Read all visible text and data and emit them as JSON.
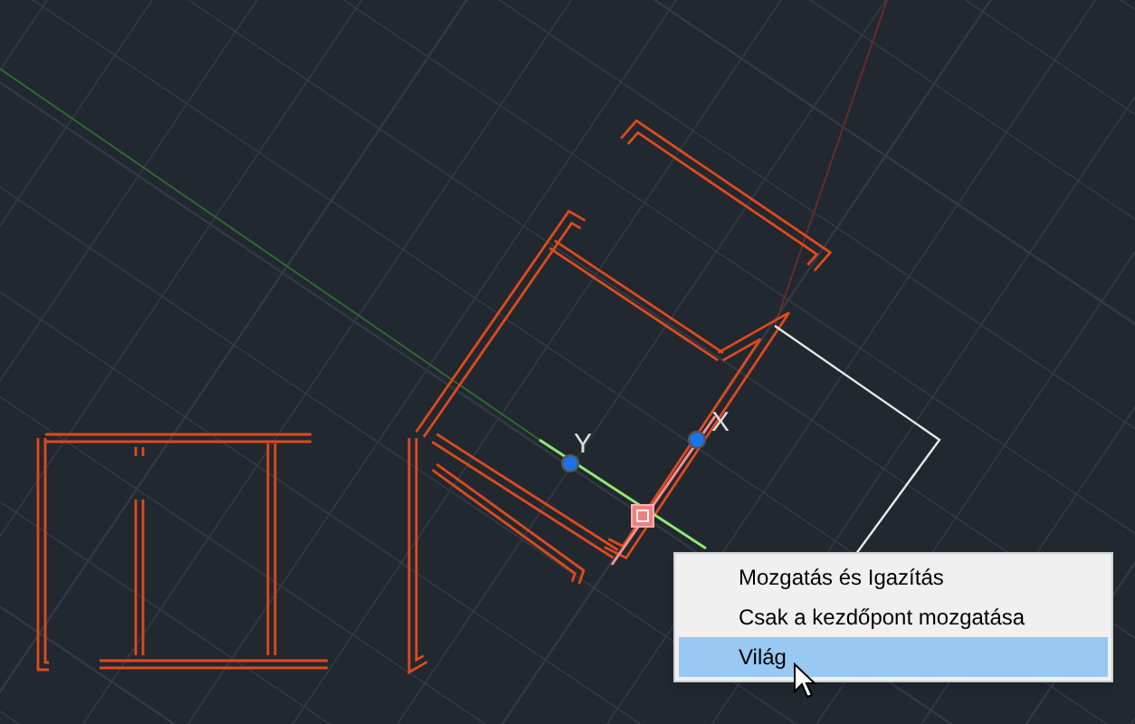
{
  "gizmo": {
    "y_label": "Y",
    "x_label": "X"
  },
  "context_menu": {
    "items": [
      {
        "label": "Mozgatás és Igazítás",
        "selected": false
      },
      {
        "label": "Csak a kezdőpont mozgatása",
        "selected": false
      },
      {
        "label": "Világ",
        "selected": true
      }
    ]
  }
}
